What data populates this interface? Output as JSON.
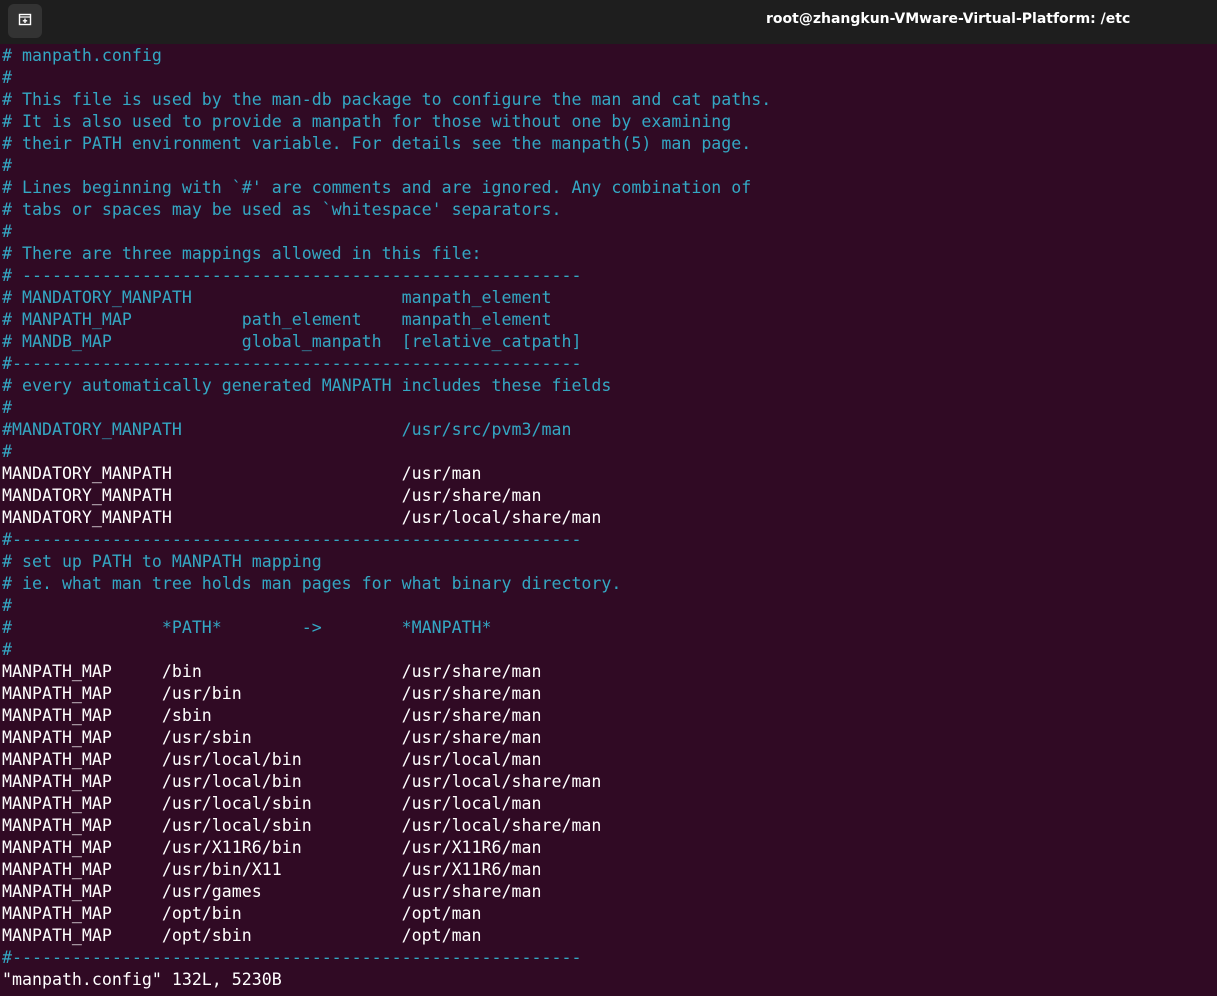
{
  "window": {
    "title": "root@zhangkun-VMware-Virtual-Platform: /etc",
    "new_tab_icon": "new-tab-icon"
  },
  "colors": {
    "background": "#300a24",
    "titlebar": "#1e1e1e",
    "comment": "#34a7c3",
    "text": "#ffffff"
  },
  "editor": {
    "lines": [
      {
        "text": "# manpath.config",
        "type": "comment"
      },
      {
        "text": "#",
        "type": "comment"
      },
      {
        "text": "# This file is used by the man-db package to configure the man and cat paths.",
        "type": "comment"
      },
      {
        "text": "# It is also used to provide a manpath for those without one by examining",
        "type": "comment"
      },
      {
        "text": "# their PATH environment variable. For details see the manpath(5) man page.",
        "type": "comment"
      },
      {
        "text": "#",
        "type": "comment"
      },
      {
        "text": "# Lines beginning with `#' are comments and are ignored. Any combination of",
        "type": "comment"
      },
      {
        "text": "# tabs or spaces may be used as `whitespace' separators.",
        "type": "comment"
      },
      {
        "text": "#",
        "type": "comment"
      },
      {
        "text": "# There are three mappings allowed in this file:",
        "type": "comment"
      },
      {
        "text": "# --------------------------------------------------------",
        "type": "comment"
      },
      {
        "text": "# MANDATORY_MANPATH                     manpath_element",
        "type": "comment"
      },
      {
        "text": "# MANPATH_MAP           path_element    manpath_element",
        "type": "comment"
      },
      {
        "text": "# MANDB_MAP             global_manpath  [relative_catpath]",
        "type": "comment"
      },
      {
        "text": "#---------------------------------------------------------",
        "type": "comment"
      },
      {
        "text": "# every automatically generated MANPATH includes these fields",
        "type": "comment"
      },
      {
        "text": "#",
        "type": "comment"
      },
      {
        "text": "#MANDATORY_MANPATH                      /usr/src/pvm3/man",
        "type": "comment"
      },
      {
        "text": "#",
        "type": "comment"
      },
      {
        "text": "MANDATORY_MANPATH                       /usr/man",
        "type": "code"
      },
      {
        "text": "MANDATORY_MANPATH                       /usr/share/man",
        "type": "code"
      },
      {
        "text": "MANDATORY_MANPATH                       /usr/local/share/man",
        "type": "code"
      },
      {
        "text": "#---------------------------------------------------------",
        "type": "comment"
      },
      {
        "text": "# set up PATH to MANPATH mapping",
        "type": "comment"
      },
      {
        "text": "# ie. what man tree holds man pages for what binary directory.",
        "type": "comment"
      },
      {
        "text": "#",
        "type": "comment"
      },
      {
        "text": "#               *PATH*        ->        *MANPATH*",
        "type": "comment"
      },
      {
        "text": "#",
        "type": "comment"
      },
      {
        "text": "MANPATH_MAP     /bin                    /usr/share/man",
        "type": "code"
      },
      {
        "text": "MANPATH_MAP     /usr/bin                /usr/share/man",
        "type": "code"
      },
      {
        "text": "MANPATH_MAP     /sbin                   /usr/share/man",
        "type": "code"
      },
      {
        "text": "MANPATH_MAP     /usr/sbin               /usr/share/man",
        "type": "code"
      },
      {
        "text": "MANPATH_MAP     /usr/local/bin          /usr/local/man",
        "type": "code"
      },
      {
        "text": "MANPATH_MAP     /usr/local/bin          /usr/local/share/man",
        "type": "code"
      },
      {
        "text": "MANPATH_MAP     /usr/local/sbin         /usr/local/man",
        "type": "code"
      },
      {
        "text": "MANPATH_MAP     /usr/local/sbin         /usr/local/share/man",
        "type": "code"
      },
      {
        "text": "MANPATH_MAP     /usr/X11R6/bin          /usr/X11R6/man",
        "type": "code"
      },
      {
        "text": "MANPATH_MAP     /usr/bin/X11            /usr/X11R6/man",
        "type": "code"
      },
      {
        "text": "MANPATH_MAP     /usr/games              /usr/share/man",
        "type": "code"
      },
      {
        "text": "MANPATH_MAP     /opt/bin                /opt/man",
        "type": "code"
      },
      {
        "text": "MANPATH_MAP     /opt/sbin               /opt/man",
        "type": "code"
      },
      {
        "text": "#---------------------------------------------------------",
        "type": "comment"
      }
    ],
    "status_line": "\"manpath.config\" 132L, 5230B"
  }
}
